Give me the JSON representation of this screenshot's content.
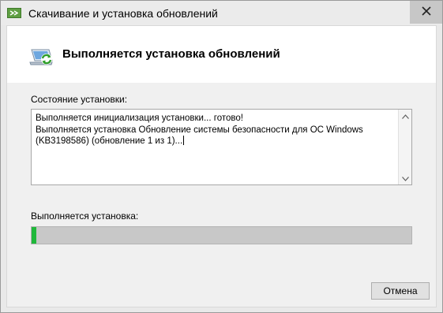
{
  "window": {
    "title": "Скачивание и установка обновлений",
    "app_icon": "windows-update-icon",
    "close_icon": "close-icon"
  },
  "header": {
    "icon": "update-icon",
    "title": "Выполняется установка обновлений"
  },
  "status": {
    "label": "Состояние установки:",
    "log_lines": [
      "Выполняется инициализация установки... готово!",
      "Выполняется установка Обновление системы безопасности для ОС Windows",
      "(KB3198586) (обновление  1 из 1)..."
    ]
  },
  "progress": {
    "label": "Выполняется установка:",
    "fraction": 0.012,
    "color": "#1fb83a"
  },
  "buttons": {
    "cancel_label": "Отмена"
  }
}
